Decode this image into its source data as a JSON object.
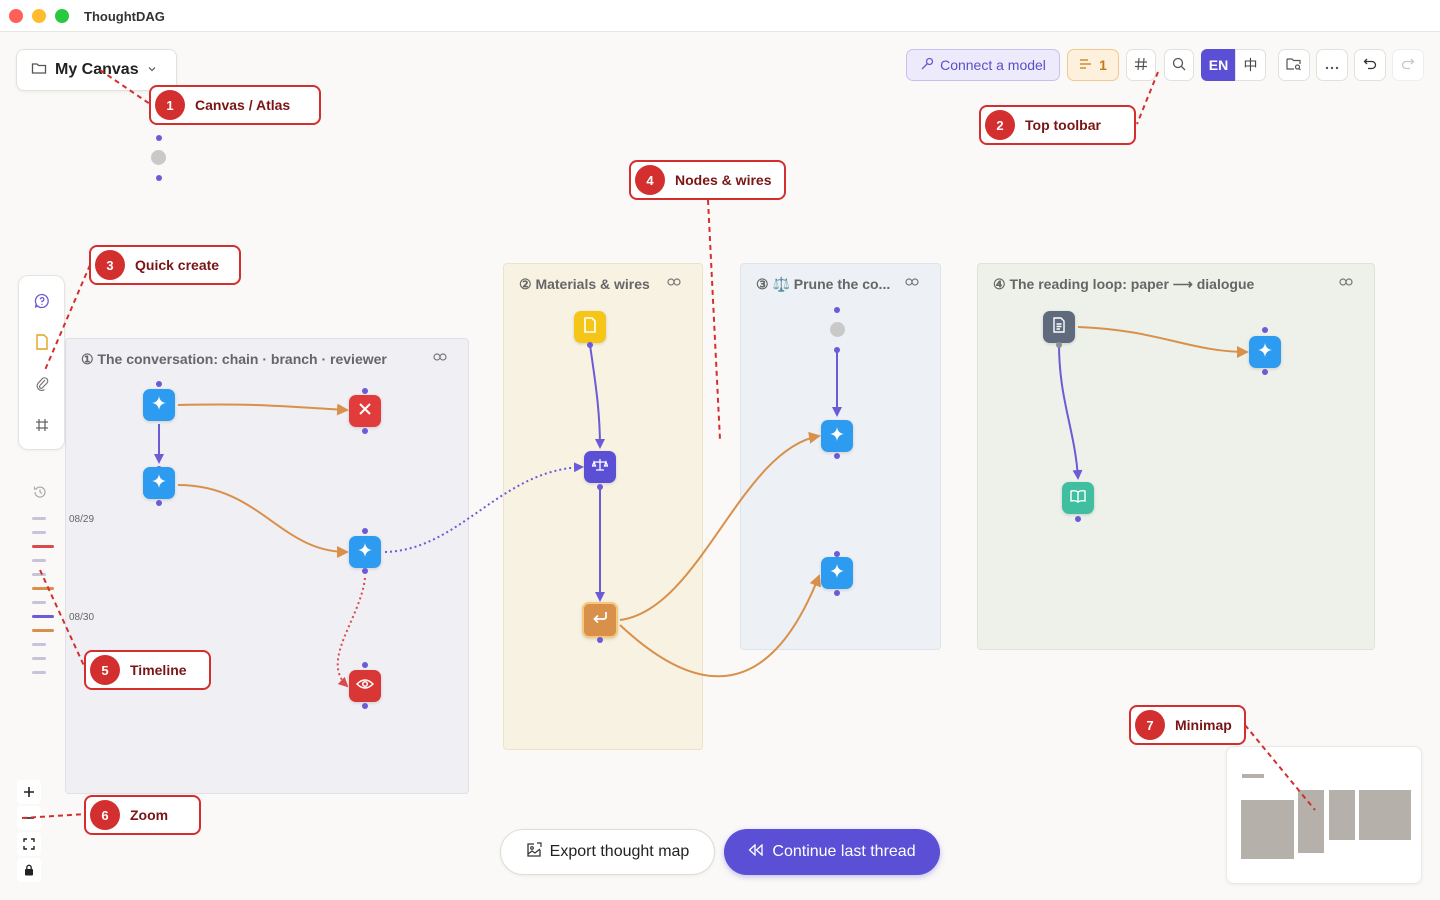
{
  "window": {
    "title": "ThoughtDAG"
  },
  "canvas_selector": {
    "label": "My Canvas"
  },
  "toolbar": {
    "connect_model": "Connect a model",
    "queue_count": "1",
    "lang_en": "EN",
    "lang_zh": "中"
  },
  "groups": [
    {
      "title": "① The conversation: chain · branch · reviewer"
    },
    {
      "title": "② Materials & wires"
    },
    {
      "title": "③ ⚖️ Prune the co..."
    },
    {
      "title": "④ The reading loop: paper ⟶ dialogue"
    }
  ],
  "timeline": {
    "dates": [
      "08/29",
      "08/30"
    ]
  },
  "callouts": [
    {
      "num": "1",
      "label": "Canvas / Atlas"
    },
    {
      "num": "2",
      "label": "Top toolbar"
    },
    {
      "num": "3",
      "label": "Quick create"
    },
    {
      "num": "4",
      "label": "Nodes & wires"
    },
    {
      "num": "5",
      "label": "Timeline"
    },
    {
      "num": "6",
      "label": "Zoom"
    },
    {
      "num": "7",
      "label": "Minimap"
    }
  ],
  "bottom": {
    "export": "Export thought map",
    "continue": "Continue last thread"
  },
  "colors": {
    "accent": "#6b5bd6",
    "node_blue": "#2d9cf0",
    "node_red": "#e23b3b",
    "node_yellow": "#f5c518",
    "node_orange": "#d9904a",
    "node_slate": "#5f6b7d",
    "node_teal": "#3fbfa0",
    "wire_orange": "#d9904a",
    "callout_red": "#d32f2f"
  }
}
